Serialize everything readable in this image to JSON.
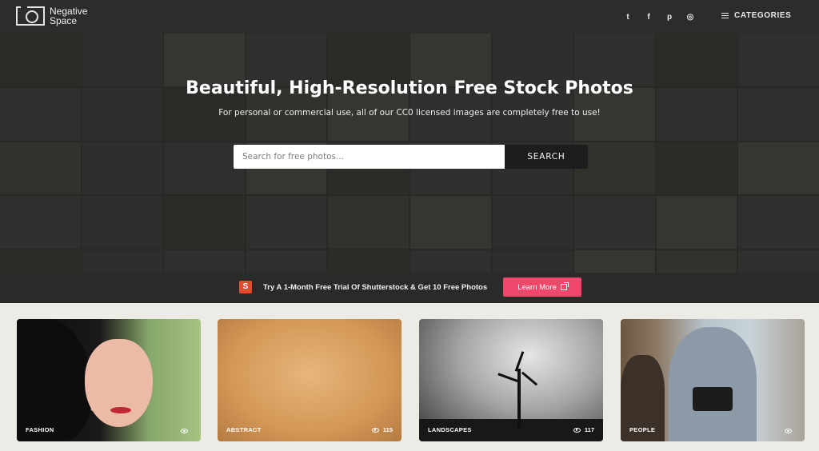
{
  "nav": {
    "logo_line1": "Negative",
    "logo_line2": "Space",
    "social": [
      {
        "icon": "twitter-icon",
        "glyph": "t"
      },
      {
        "icon": "facebook-icon",
        "glyph": "f"
      },
      {
        "icon": "pinterest-icon",
        "glyph": "p"
      },
      {
        "icon": "instagram-icon",
        "glyph": "◎"
      }
    ],
    "categories_label": "CATEGORIES"
  },
  "hero": {
    "title": "Beautiful, High-Resolution Free Stock Photos",
    "subtitle": "For personal or commercial use, all of our CC0 licensed images are completely free to use!",
    "search_placeholder": "Search for free photos...",
    "search_button": "SEARCH"
  },
  "promo": {
    "icon_glyph": "S",
    "text": "Try A 1-Month Free Trial Of Shutterstock & Get 10 Free Photos",
    "button_label": "Learn More"
  },
  "cards": [
    {
      "label": "FASHION",
      "views": ""
    },
    {
      "label": "ABSTRACT",
      "views": "115"
    },
    {
      "label": "LANDSCAPES",
      "views": "117"
    },
    {
      "label": "PEOPLE",
      "views": ""
    }
  ],
  "colors": {
    "nav_bg": "#2c2c2b",
    "accent_button": "#f0476c",
    "search_button_bg": "#1d1d1d",
    "page_bg": "#ecebe6"
  }
}
